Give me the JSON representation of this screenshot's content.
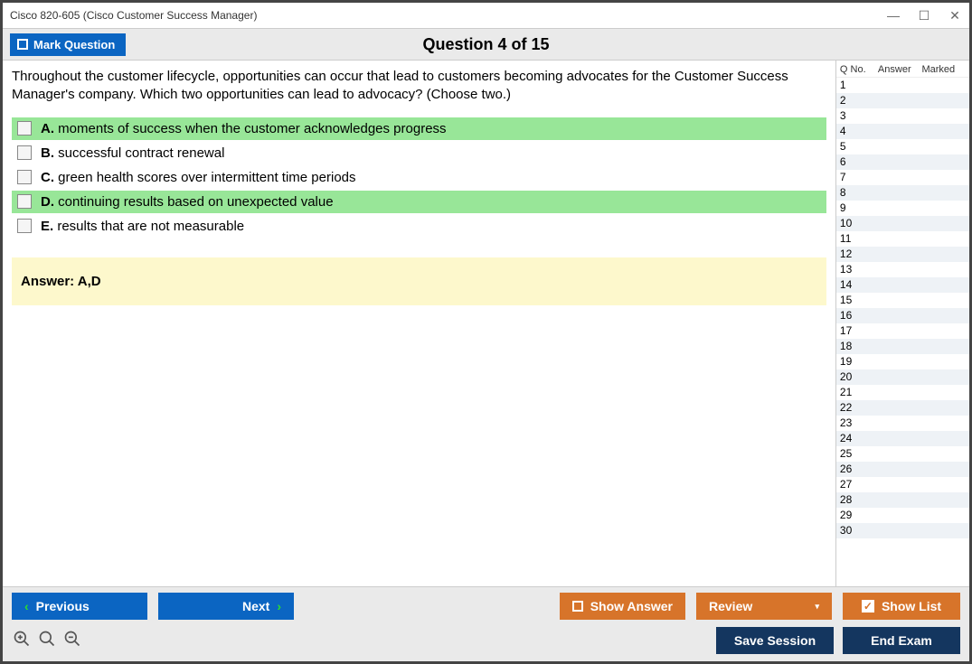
{
  "window": {
    "title": "Cisco 820-605 (Cisco Customer Success Manager)"
  },
  "toolbar": {
    "mark_label": "Mark Question",
    "heading": "Question 4 of 15"
  },
  "question": {
    "text": "Throughout the customer lifecycle, opportunities can occur that lead to customers becoming advocates for the Customer Success Manager's company. Which two opportunities can lead to advocacy? (Choose two.)",
    "options": [
      {
        "letter": "A.",
        "text": "moments of success when the customer acknowledges progress",
        "correct": true
      },
      {
        "letter": "B.",
        "text": "successful contract renewal",
        "correct": false
      },
      {
        "letter": "C.",
        "text": "green health scores over intermittent time periods",
        "correct": false
      },
      {
        "letter": "D.",
        "text": "continuing results based on unexpected value",
        "correct": true
      },
      {
        "letter": "E.",
        "text": "results that are not measurable",
        "correct": false
      }
    ],
    "answer_label": "Answer: A,D"
  },
  "sidebar": {
    "cols": {
      "qno": "Q No.",
      "answer": "Answer",
      "marked": "Marked"
    },
    "rows": [
      {
        "n": "1"
      },
      {
        "n": "2"
      },
      {
        "n": "3"
      },
      {
        "n": "4"
      },
      {
        "n": "5"
      },
      {
        "n": "6"
      },
      {
        "n": "7"
      },
      {
        "n": "8"
      },
      {
        "n": "9"
      },
      {
        "n": "10"
      },
      {
        "n": "11"
      },
      {
        "n": "12"
      },
      {
        "n": "13"
      },
      {
        "n": "14"
      },
      {
        "n": "15"
      },
      {
        "n": "16"
      },
      {
        "n": "17"
      },
      {
        "n": "18"
      },
      {
        "n": "19"
      },
      {
        "n": "20"
      },
      {
        "n": "21"
      },
      {
        "n": "22"
      },
      {
        "n": "23"
      },
      {
        "n": "24"
      },
      {
        "n": "25"
      },
      {
        "n": "26"
      },
      {
        "n": "27"
      },
      {
        "n": "28"
      },
      {
        "n": "29"
      },
      {
        "n": "30"
      }
    ]
  },
  "footer": {
    "prev": "Previous",
    "next": "Next",
    "show_answer": "Show Answer",
    "review": "Review",
    "show_list": "Show List",
    "save_session": "Save Session",
    "end_exam": "End Exam"
  }
}
